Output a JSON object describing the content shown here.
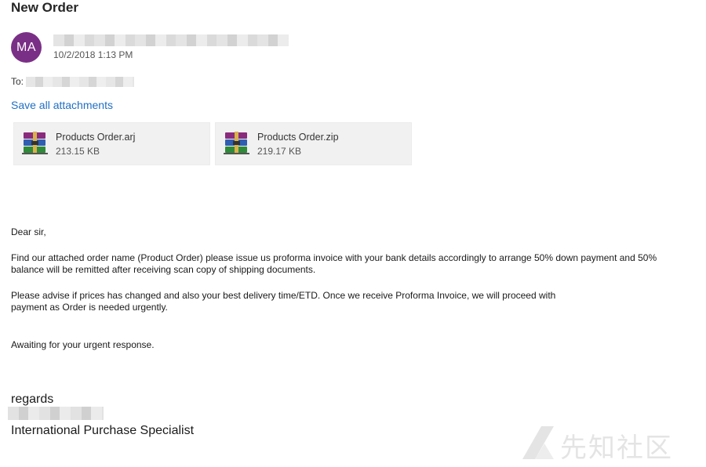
{
  "email": {
    "subject": "New Order",
    "sender_initials": "MA",
    "timestamp": "10/2/2018 1:13 PM",
    "to_label": "To:"
  },
  "attachments_bar": {
    "save_all_label": "Save all attachments"
  },
  "attachments": [
    {
      "name": "Products Order.arj",
      "size": "213.15 KB",
      "icon": "archive-rar-icon"
    },
    {
      "name": "Products Order.zip",
      "size": "219.17 KB",
      "icon": "archive-rar-icon"
    }
  ],
  "body": {
    "greeting": "Dear sir,",
    "paragraph1": "Find our attached order name (Product Order) please issue us proforma invoice with your bank details accordingly to arrange 50% down payment and 50%\nbalance will be remitted after receiving scan copy of shipping documents.",
    "paragraph2": "Please advise if prices has changed and also your best delivery time/ETD. Once we receive Proforma Invoice, we will proceed with\npayment as Order is needed urgently.",
    "paragraph3": "Awaiting for your urgent response.",
    "regards": "regards",
    "signature_title": "International Purchase Specialist"
  },
  "watermark": {
    "text": "先知社区"
  },
  "colors": {
    "avatar_bg": "#7a2f86",
    "link": "#1f6fc5",
    "attachment_bg": "#f1f1f1"
  }
}
